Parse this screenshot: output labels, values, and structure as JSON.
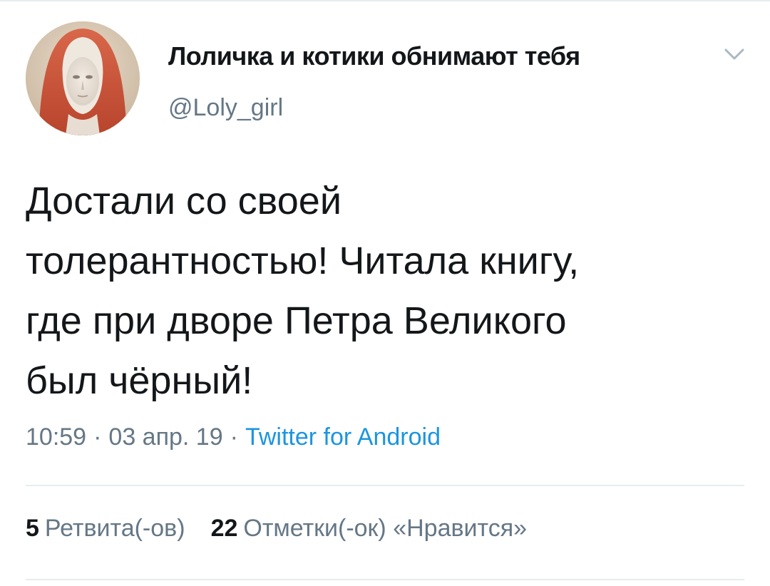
{
  "tweet": {
    "author": {
      "display_name": "Лоличка и котики обнимают тебя",
      "handle": "@Loly_girl",
      "avatar_icon": "portrait-avatar"
    },
    "menu_icon": "chevron-down-icon",
    "text_lines": [
      "Достали со своей",
      "толерантностью! Читала книгу,",
      "где при дворе Петра Великого",
      "был чёрный!"
    ],
    "meta": {
      "time": "10:59",
      "date": "03 апр. 19",
      "separator": "·",
      "source": "Twitter for Android"
    },
    "stats": {
      "retweets_count": "5",
      "retweets_label": "Ретвита(-ов)",
      "likes_count": "22",
      "likes_label": "Отметки(-ок) «Нравится»"
    },
    "colors": {
      "text": "#14171a",
      "secondary": "#657786",
      "link": "#1b95e0",
      "divider": "#e6ecf0"
    }
  }
}
